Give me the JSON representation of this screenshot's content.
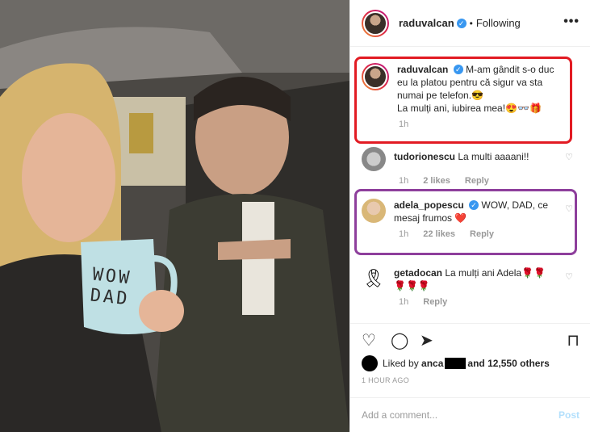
{
  "post": {
    "author": "raduvalcan",
    "dot": "•",
    "following": "Following",
    "more": "•••"
  },
  "photo": {
    "mug_line1": "WOW",
    "mug_line2": "DAD"
  },
  "comments": [
    {
      "user": "raduvalcan",
      "text": "M-am gândit s-o duc eu la platou pentru că sigur va sta numai pe telefon.😎",
      "text2": "La mulți ani, iubirea mea!😍👓🎁",
      "time": "1h",
      "likes": "",
      "reply": ""
    },
    {
      "user": "tudorionescu",
      "text": "La multi aaaani!!",
      "text2": "",
      "time": "1h",
      "likes": "2 likes",
      "reply": "Reply"
    },
    {
      "user": "adela_popescu",
      "text": "WOW, DAD, ce mesaj frumos ❤️",
      "text2": "",
      "time": "1h",
      "likes": "22 likes",
      "reply": "Reply"
    },
    {
      "user": "getadocan",
      "text": "La mulți ani Adela🌹🌹🌹🌹🌹",
      "text2": "",
      "time": "1h",
      "likes": "",
      "reply": "Reply"
    }
  ],
  "likes": {
    "prefix": "Liked by",
    "user": "anca",
    "suffix": "and 12,550 others"
  },
  "time_ago": "1 HOUR AGO",
  "add_comment": {
    "placeholder": "Add a comment...",
    "post": "Post"
  },
  "colors": {
    "highlight_red": "#e21b23",
    "highlight_purple": "#8e3f9c",
    "verified": "#3897f0"
  }
}
